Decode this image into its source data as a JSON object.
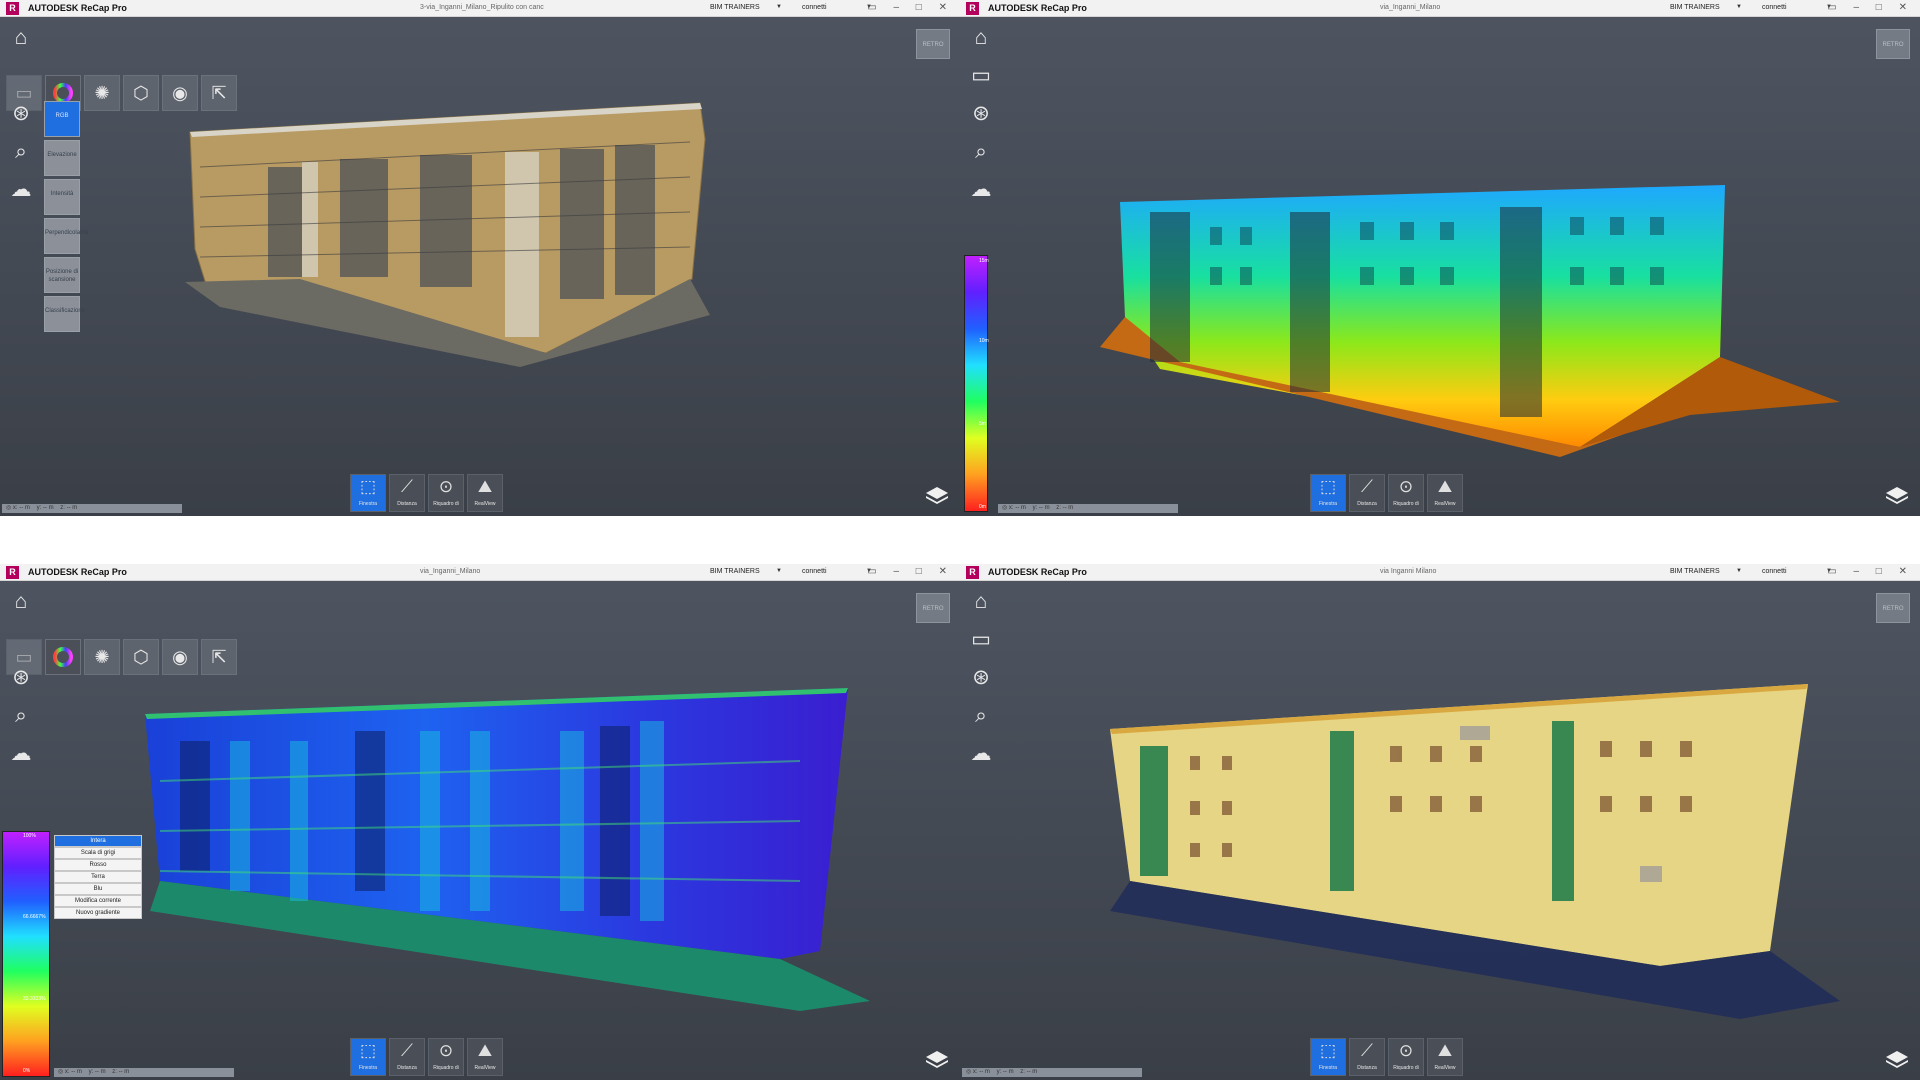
{
  "windows": [
    {
      "id": "q1",
      "app_title": "AUTODESK ReCap Pro",
      "file_title": "3-via_Inganni_Milano_Ripulito con canc",
      "user": "BIM TRAINERS",
      "connect": "connetti",
      "tools_row": [
        "monitor-icon",
        "color-wheel-icon",
        "lightbulb-icon",
        "cube-icon",
        "eye-icon",
        "export-icon"
      ],
      "color_modes": [
        "RGB",
        "Elevazione",
        "Intensità",
        "Perpendicolarità",
        "Posizione di scansione",
        "Classificazione"
      ],
      "selected_color_mode": "RGB",
      "coords": {
        "x": "x: -- m",
        "y": "y: -- m",
        "z": "z: -- m"
      },
      "bottom_tools": [
        {
          "label": "Finestra",
          "icon": "window-select-icon",
          "active": true
        },
        {
          "label": "Distanza",
          "icon": "measure-distance-icon",
          "active": false
        },
        {
          "label": "Riquadro di",
          "icon": "clip-box-icon",
          "active": false
        },
        {
          "label": "RealView",
          "icon": "realview-icon",
          "active": false
        }
      ],
      "render_style": "rgb"
    },
    {
      "id": "q2",
      "app_title": "AUTODESK ReCap Pro",
      "file_title": "via_Inganni_Milano",
      "user": "BIM TRAINERS",
      "connect": "connetti",
      "scale_labels": [
        "15m",
        "10m",
        "5m",
        "0m"
      ],
      "coords": {
        "x": "x: -- m",
        "y": "y: -- m",
        "z": "z: -- m"
      },
      "bottom_tools": [
        {
          "label": "Finestra",
          "icon": "window-select-icon",
          "active": true
        },
        {
          "label": "Distanza",
          "icon": "measure-distance-icon",
          "active": false
        },
        {
          "label": "Riquadro di",
          "icon": "clip-box-icon",
          "active": false
        },
        {
          "label": "RealView",
          "icon": "realview-icon",
          "active": false
        }
      ],
      "render_style": "elevation"
    },
    {
      "id": "q3",
      "app_title": "AUTODESK ReCap Pro",
      "file_title": "via_Inganni_Milano",
      "user": "BIM TRAINERS",
      "connect": "connetti",
      "tools_row": [
        "monitor-icon",
        "color-wheel-icon",
        "lightbulb-icon",
        "cube-icon",
        "eye-icon",
        "export-icon"
      ],
      "scale_labels": [
        "100%",
        "66.6667%",
        "33.3333%",
        "0%"
      ],
      "gradient_options": [
        "Intera",
        "Scala di grigi",
        "Rosso",
        "Terra",
        "Blu",
        "Modifica corrente",
        "Nuovo gradiente"
      ],
      "selected_gradient": "Intera",
      "coords": {
        "x": "x: -- m",
        "y": "y: -- m",
        "z": "z: -- m"
      },
      "bottom_tools": [
        {
          "label": "Finestra",
          "icon": "window-select-icon",
          "active": true
        },
        {
          "label": "Distanza",
          "icon": "measure-distance-icon",
          "active": false
        },
        {
          "label": "Riquadro di",
          "icon": "clip-box-icon",
          "active": false
        },
        {
          "label": "RealView",
          "icon": "realview-icon",
          "active": false
        }
      ],
      "render_style": "intensity"
    },
    {
      "id": "q4",
      "app_title": "AUTODESK ReCap Pro",
      "file_title": "via Inganni Milano",
      "user": "BIM TRAINERS",
      "connect": "connetti",
      "coords": {
        "x": "x: -- m",
        "y": "y: -- m",
        "z": "z: -- m"
      },
      "bottom_tools": [
        {
          "label": "Finestra",
          "icon": "window-select-icon",
          "active": true
        },
        {
          "label": "Distanza",
          "icon": "measure-distance-icon",
          "active": false
        },
        {
          "label": "Riquadro di",
          "icon": "clip-box-icon",
          "active": false
        },
        {
          "label": "RealView",
          "icon": "realview-icon",
          "active": false
        }
      ],
      "render_style": "normal"
    }
  ],
  "colors": {
    "viewport_top": "#4e5561",
    "viewport_bottom": "#3a3f47",
    "accent_blue": "#1f6fe0",
    "brand": "#b3005c"
  }
}
